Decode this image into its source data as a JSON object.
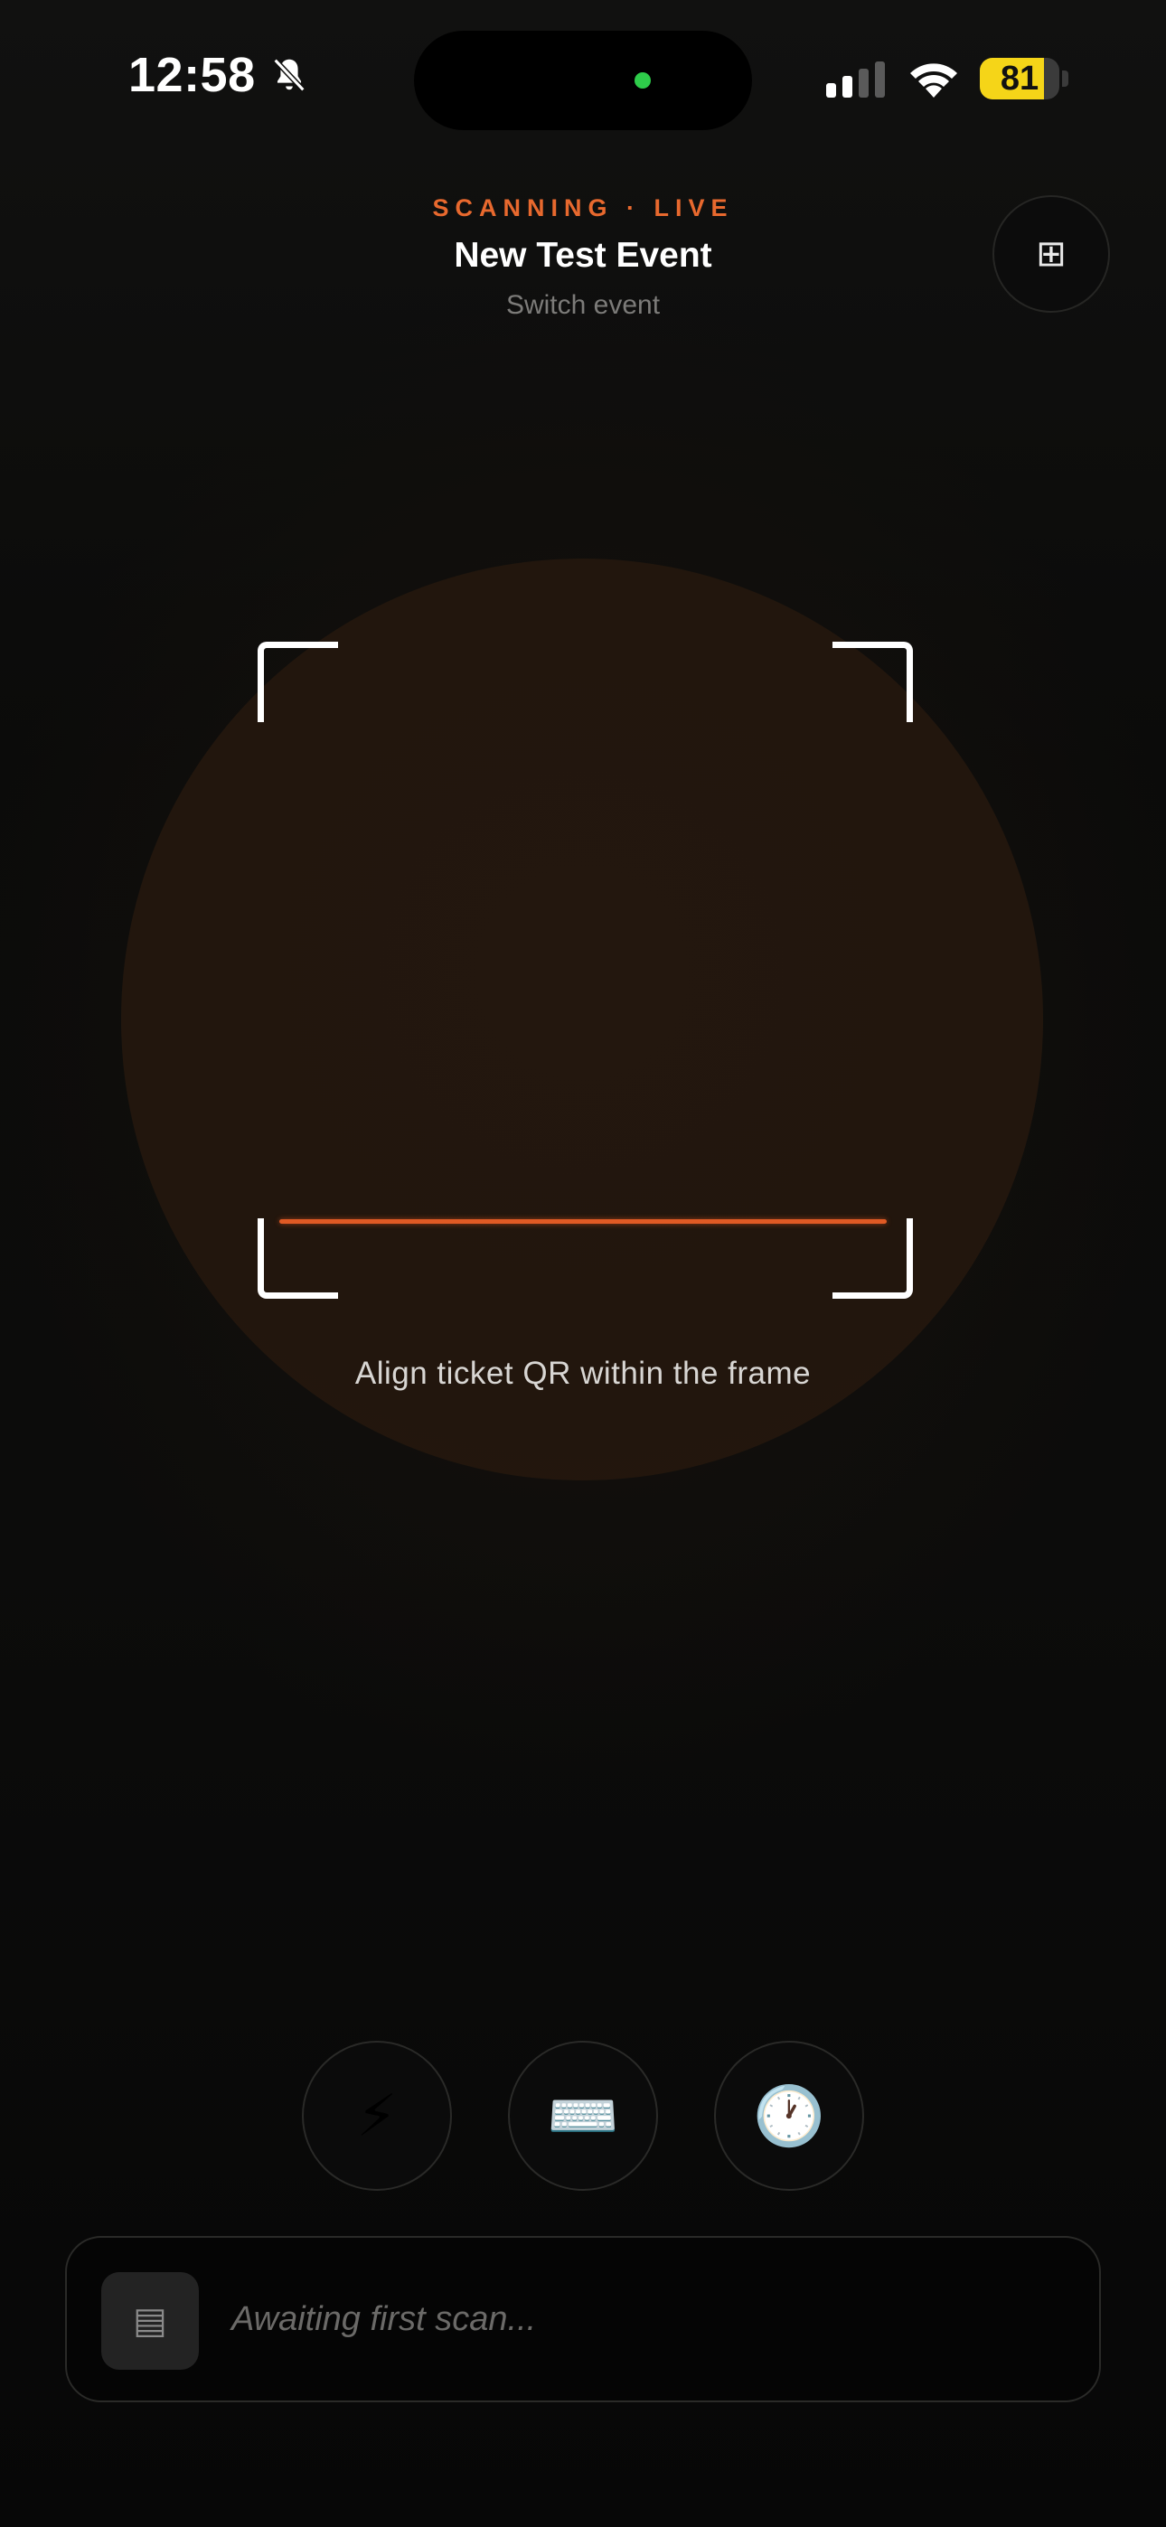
{
  "status_bar": {
    "time": "12:58",
    "battery_percent": "81",
    "battery_level": 0.81,
    "icons": [
      "bell-slash-icon",
      "cellular-signal-icon",
      "wifi-icon",
      "battery-icon"
    ]
  },
  "header": {
    "status_label": "SCANNING · LIVE",
    "event_title": "New Test Event",
    "switch_event_label": "Switch event",
    "grid_button_icon": "⊞"
  },
  "scanner": {
    "hint": "Align ticket QR within the frame",
    "accent_color": "#e05a24"
  },
  "controls": {
    "flash_icon": "⚡",
    "keyboard_icon": "⌨️",
    "history_icon": "🕐"
  },
  "result": {
    "icon": "▤",
    "text": "Awaiting first scan..."
  }
}
